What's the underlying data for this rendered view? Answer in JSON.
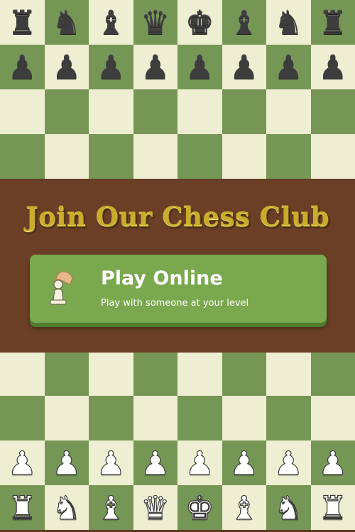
{
  "banner": {
    "headline": "Join Our Chess Club",
    "play_button": {
      "title": "Play Online",
      "subtitle": "Play with someone at your level",
      "icon": "hand-holding-pawn-icon"
    }
  },
  "colors": {
    "light_square": "#eeeed2",
    "dark_square": "#769656",
    "banner_background": "#6a3f26",
    "button": "#7aa84f",
    "headline_gold": "#c9ac2b"
  },
  "board_top": {
    "rows": [
      {
        "colors": [
          "light",
          "dark",
          "light",
          "dark",
          "light",
          "dark",
          "light",
          "dark"
        ],
        "pieces": [
          "rook",
          "knight",
          "bishop",
          "queen",
          "king",
          "bishop",
          "knight",
          "rook"
        ],
        "side": "black"
      },
      {
        "colors": [
          "dark",
          "light",
          "dark",
          "light",
          "dark",
          "light",
          "dark",
          "light"
        ],
        "pieces": [
          "pawn",
          "pawn",
          "pawn",
          "pawn",
          "pawn",
          "pawn",
          "pawn",
          "pawn"
        ],
        "side": "black"
      },
      {
        "colors": [
          "light",
          "dark",
          "light",
          "dark",
          "light",
          "dark",
          "light",
          "dark"
        ],
        "pieces": [
          "",
          "",
          "",
          "",
          "",
          "",
          "",
          ""
        ],
        "side": ""
      },
      {
        "colors": [
          "dark",
          "light",
          "dark",
          "light",
          "dark",
          "light",
          "dark",
          "light"
        ],
        "pieces": [
          "",
          "",
          "",
          "",
          "",
          "",
          "",
          ""
        ],
        "side": ""
      }
    ]
  },
  "board_bottom": {
    "rows": [
      {
        "colors": [
          "light",
          "dark",
          "light",
          "dark",
          "light",
          "dark",
          "light",
          "dark"
        ],
        "pieces": [
          "",
          "",
          "",
          "",
          "",
          "",
          "",
          ""
        ],
        "side": ""
      },
      {
        "colors": [
          "dark",
          "light",
          "dark",
          "light",
          "dark",
          "light",
          "dark",
          "light"
        ],
        "pieces": [
          "",
          "",
          "",
          "",
          "",
          "",
          "",
          ""
        ],
        "side": ""
      },
      {
        "colors": [
          "light",
          "dark",
          "light",
          "dark",
          "light",
          "dark",
          "light",
          "dark"
        ],
        "pieces": [
          "pawn",
          "pawn",
          "pawn",
          "pawn",
          "pawn",
          "pawn",
          "pawn",
          "pawn"
        ],
        "side": "white"
      },
      {
        "colors": [
          "dark",
          "light",
          "dark",
          "light",
          "dark",
          "light",
          "dark",
          "light"
        ],
        "pieces": [
          "rook",
          "knight",
          "bishop",
          "queen",
          "king",
          "bishop",
          "knight",
          "rook"
        ],
        "side": "white"
      }
    ]
  }
}
